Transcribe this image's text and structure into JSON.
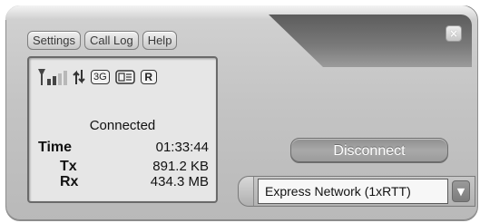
{
  "menu": {
    "settings_label": "Settings",
    "call_log_label": "Call Log",
    "help_label": "Help"
  },
  "window": {
    "close_symbol": "×"
  },
  "status": {
    "indicators": {
      "signal_icon": "signal-strength-icon",
      "signal_bars_filled": 2,
      "signal_bars_total": 4,
      "data_icon": "data-activity-arrows-icon",
      "network_type_label": "3G",
      "sms_icon": "message-icon",
      "roaming_label": "R"
    },
    "connection_text": "Connected",
    "time_label": "Time",
    "time_value": "01:33:44",
    "tx_label": "Tx",
    "tx_value": "891.2 KB",
    "rx_label": "Rx",
    "rx_value": "434.3 MB"
  },
  "actions": {
    "disconnect_label": "Disconnect"
  },
  "network": {
    "selected": "Express Network (1xRTT)"
  },
  "colors": {
    "panel_bg": "#e6e6e6",
    "chrome": "#c4c4c4",
    "notch": "#5c5c5c",
    "disconnect_bg": "#a9a9a9"
  }
}
